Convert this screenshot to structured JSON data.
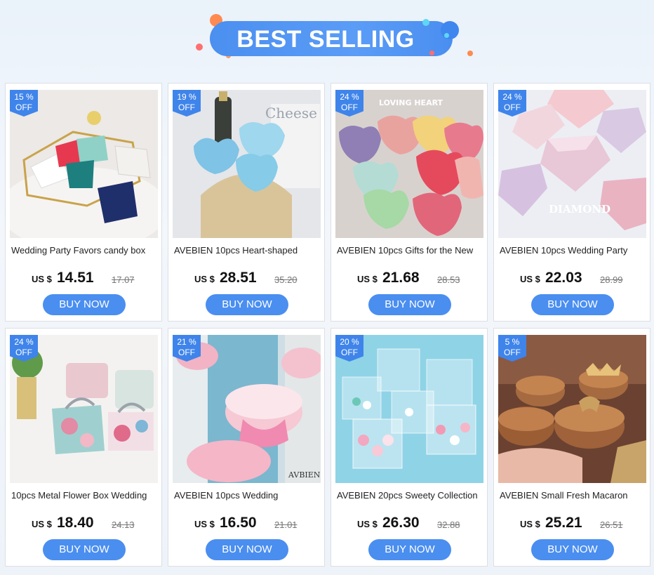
{
  "banner": {
    "title": "BEST SELLING",
    "colors": {
      "pill": "#4b8ff0",
      "accent_orange": "#ff8a50",
      "accent_cyan": "#5ed6f5"
    }
  },
  "theme": {
    "accent": "#4a8ef0",
    "badge": "#3f84ea"
  },
  "products": [
    {
      "discount": "15 %",
      "off": "OFF",
      "name": "Wedding Party Favors candy box",
      "currency": "US $",
      "price": "14.51",
      "old_price": "17.07",
      "buy": "BUY NOW",
      "image": "gift-boxes-tray"
    },
    {
      "discount": "19 %",
      "off": "OFF",
      "name": "AVEBIEN 10pcs Heart-shaped",
      "currency": "US $",
      "price": "28.51",
      "old_price": "35.20",
      "buy": "BUY NOW",
      "image": "blue-heart-tins",
      "image_text": "Cheese"
    },
    {
      "discount": "24 %",
      "off": "OFF",
      "name": "AVEBIEN 10pcs Gifts for the New",
      "currency": "US $",
      "price": "21.68",
      "old_price": "28.53",
      "buy": "BUY NOW",
      "image": "colorful-heart-tins",
      "image_text": "LOVING HEART"
    },
    {
      "discount": "24 %",
      "off": "OFF",
      "name": "AVEBIEN 10pcs Wedding Party",
      "currency": "US $",
      "price": "22.03",
      "old_price": "28.99",
      "buy": "BUY NOW",
      "image": "diamond-boxes",
      "image_text": "DIAMOND"
    },
    {
      "discount": "24 %",
      "off": "OFF",
      "name": "10pcs Metal Flower Box Wedding",
      "currency": "US $",
      "price": "18.40",
      "old_price": "24.13",
      "buy": "BUY NOW",
      "image": "floral-handbag-tins"
    },
    {
      "discount": "21 %",
      "off": "OFF",
      "name": "AVEBIEN 10pcs Wedding",
      "currency": "US $",
      "price": "16.50",
      "old_price": "21.01",
      "buy": "BUY NOW",
      "image": "pink-round-tins",
      "image_text": "AVBIEN"
    },
    {
      "discount": "20 %",
      "off": "OFF",
      "name": "AVEBIEN 20pcs Sweety Collection",
      "currency": "US $",
      "price": "26.30",
      "old_price": "32.88",
      "buy": "BUY NOW",
      "image": "clear-cube-boxes"
    },
    {
      "discount": "5  %",
      "off": "OFF",
      "name": "AVEBIEN Small Fresh Macaron",
      "currency": "US $",
      "price": "25.21",
      "old_price": "26.51",
      "buy": "BUY NOW",
      "image": "macaron-boxes"
    }
  ]
}
